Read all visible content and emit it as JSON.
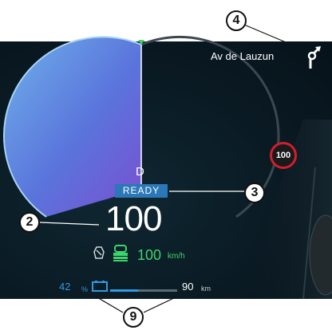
{
  "navigation": {
    "street": "Av de Lauzun",
    "maneuver_icon": "roundabout-turn-icon"
  },
  "speedometer": {
    "gear": "D",
    "status": "READY",
    "speed": "100",
    "accent_color": "#5b7fe0"
  },
  "cruise_control": {
    "value": "100",
    "unit": "km/h",
    "icons": [
      "speed-limiter-icon",
      "cruise-control-icon"
    ],
    "color": "#3ed46b"
  },
  "speed_limit_sign": {
    "value": "100",
    "color": "#d21e2b"
  },
  "battery": {
    "percent_value": "42",
    "percent_unit": "%",
    "level_fraction": 0.42,
    "icon": "battery-icon",
    "color": "#2f9ae0"
  },
  "range": {
    "value": "90",
    "unit": "km"
  },
  "callouts": {
    "c2": "2",
    "c3": "3",
    "c4": "4",
    "c9": "9"
  }
}
